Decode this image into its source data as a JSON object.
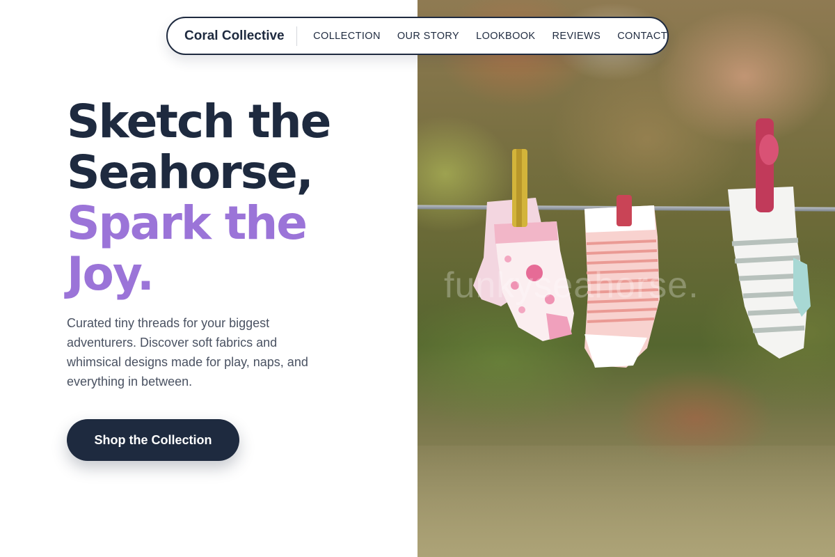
{
  "nav": {
    "brand": "Coral Collective",
    "links": [
      "COLLECTION",
      "OUR STORY",
      "LOOKBOOK",
      "REVIEWS",
      "CONTACT"
    ]
  },
  "hero": {
    "headline_line1": "Sketch the",
    "headline_line2": "Seahorse,",
    "headline_line3": "Spark the",
    "headline_line4": "Joy.",
    "description": "Curated tiny threads for your biggest adventurers. Discover soft fabrics and whimsical designs made for play, naps, and everything in between.",
    "cta_label": "Shop the Collection"
  },
  "photo": {
    "watermark": "funkyseahorse."
  },
  "colors": {
    "navy": "#1e2a3f",
    "accent_purple": "#9b74d8",
    "body_text": "#4a5262"
  }
}
